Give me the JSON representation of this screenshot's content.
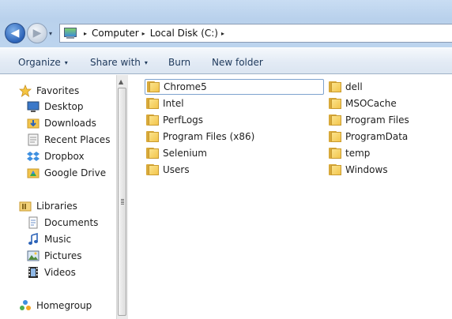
{
  "address": {
    "history_caret": "▾",
    "separator": "▸",
    "crumbs": [
      "Computer",
      "Local Disk (C:)"
    ],
    "trailing_separator": "▸"
  },
  "toolbar": {
    "organize": "Organize",
    "share_with": "Share with",
    "burn": "Burn",
    "new_folder": "New folder",
    "caret": "▾"
  },
  "nav": {
    "favorites": {
      "label": "Favorites",
      "items": [
        "Desktop",
        "Downloads",
        "Recent Places",
        "Dropbox",
        "Google Drive"
      ]
    },
    "libraries": {
      "label": "Libraries",
      "items": [
        "Documents",
        "Music",
        "Pictures",
        "Videos"
      ]
    },
    "homegroup": "Homegroup"
  },
  "files": {
    "column1": [
      "Chrome5",
      "Intel",
      "PerfLogs",
      "Program Files (x86)",
      "Selenium",
      "Users"
    ],
    "column2": [
      "dell",
      "MSOCache",
      "Program Files",
      "ProgramData",
      "temp",
      "Windows"
    ],
    "selected": "Chrome5"
  },
  "colors": {
    "accent": "#2c63b8",
    "folder": "#f3c54c",
    "toolbar_text": "#1e395b"
  },
  "icons": {
    "back": "back-arrow-icon",
    "forward": "forward-arrow-icon",
    "folder": "folder-icon"
  }
}
